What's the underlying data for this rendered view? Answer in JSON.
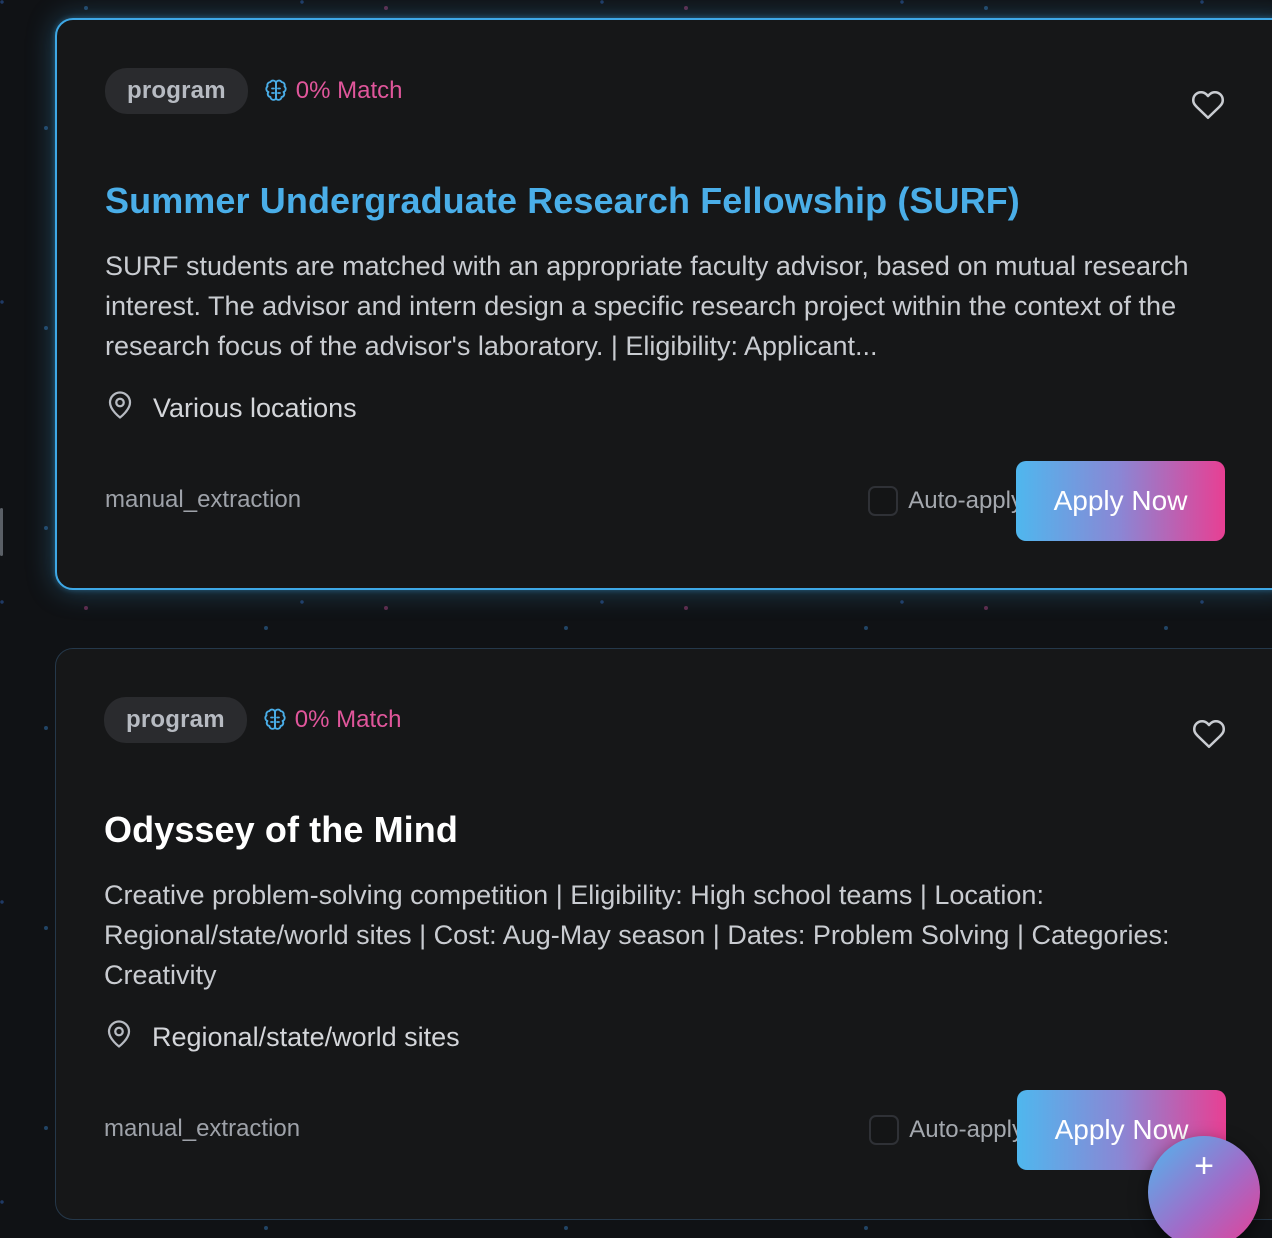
{
  "cards": [
    {
      "type_label": "program",
      "match_label": "0% Match",
      "title": "Summer Undergraduate Research Fellowship (SURF)",
      "description": "SURF students are matched with an appropriate faculty advisor, based on mutual research interest. The advisor and intern design a specific research project within the context of the research focus of the advisor's laboratory. | Eligibility: Applicant...",
      "location": "Various locations",
      "source": "manual_extraction",
      "auto_apply_label": "Auto-apply",
      "apply_label": "Apply Now"
    },
    {
      "type_label": "program",
      "match_label": "0% Match",
      "title": "Odyssey of the Mind",
      "description": "Creative problem-solving competition | Eligibility: High school teams | Location: Regional/state/world sites | Cost: Aug-May season | Dates: Problem Solving | Categories: Creativity",
      "location": "Regional/state/world sites",
      "source": "manual_extraction",
      "auto_apply_label": "Auto-apply",
      "apply_label": "Apply Now"
    }
  ],
  "fab": {
    "label": "+"
  },
  "colors": {
    "accent_blue": "#4aaee8",
    "accent_pink": "#e0569b",
    "card_bg": "#161718",
    "page_bg": "#101215"
  },
  "icons": {
    "match": "brain-icon",
    "favorite": "heart-icon",
    "location": "map-pin-icon",
    "fab": "plus-icon"
  }
}
